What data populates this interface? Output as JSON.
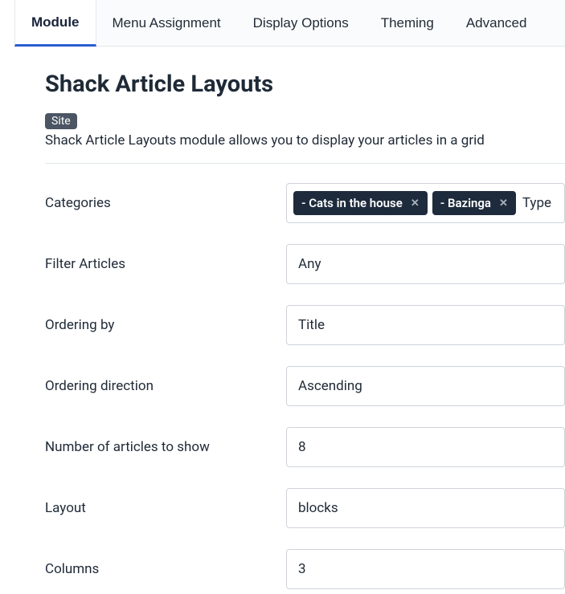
{
  "tabs": [
    {
      "label": "Module",
      "active": true
    },
    {
      "label": "Menu Assignment",
      "active": false
    },
    {
      "label": "Display Options",
      "active": false
    },
    {
      "label": "Theming",
      "active": false
    },
    {
      "label": "Advanced",
      "active": false
    }
  ],
  "header": {
    "title": "Shack Article Layouts",
    "badge": "Site",
    "description": "Shack Article Layouts module allows you to display your articles in a grid"
  },
  "fields": {
    "categories": {
      "label": "Categories",
      "type": "tags",
      "tags": [
        "- Cats in the house",
        "- Bazinga"
      ],
      "placeholder": "Type"
    },
    "filter_articles": {
      "label": "Filter Articles",
      "type": "select",
      "value": "Any"
    },
    "ordering_by": {
      "label": "Ordering by",
      "type": "select",
      "value": "Title"
    },
    "ordering_direction": {
      "label": "Ordering direction",
      "type": "select",
      "value": "Ascending"
    },
    "num_articles": {
      "label": "Number of articles to show",
      "type": "input",
      "value": "8"
    },
    "layout": {
      "label": "Layout",
      "type": "select",
      "value": "blocks"
    },
    "columns": {
      "label": "Columns",
      "type": "select",
      "value": "3"
    }
  }
}
